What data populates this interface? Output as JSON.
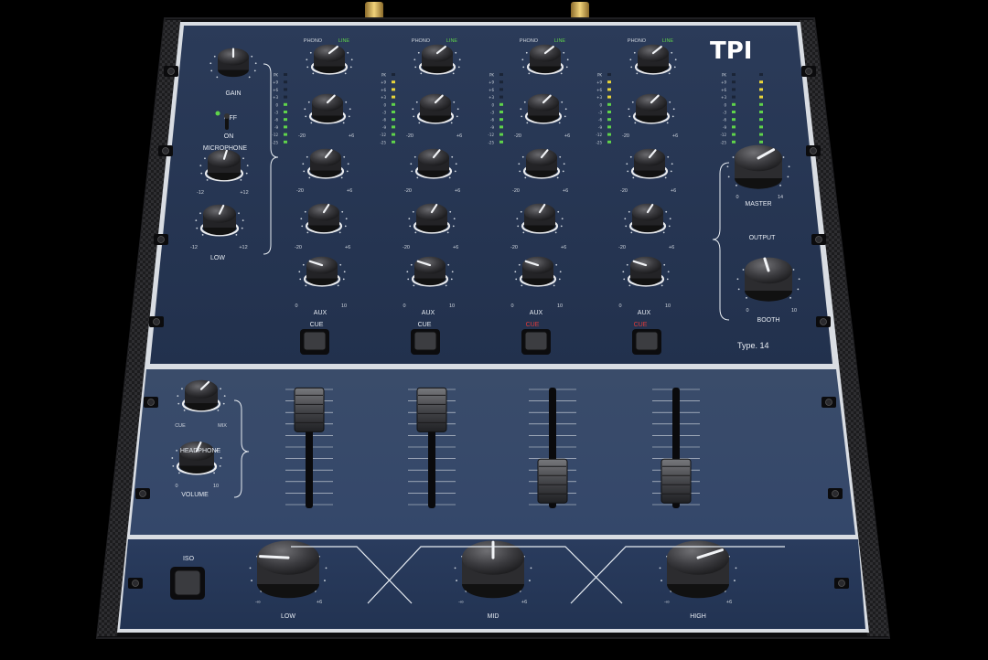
{
  "brand": "TPI",
  "model": "Type. 14",
  "colors": {
    "panel_top": "#2a3a58",
    "panel_mid": "#344664",
    "panel_bottom": "#26385a",
    "knob": "#2a2a2c",
    "led_green": "#5fd34a",
    "led_yellow": "#e7d43a",
    "led_red": "#e24a3a",
    "cue_red": "#e23a3a"
  },
  "mic": {
    "gain_label": "GAIN",
    "switch_off_label": "OFF",
    "switch_on_label": "ON",
    "section_label": "MICROPHONE",
    "low_label": "LOW",
    "range_min": "-12",
    "range_max": "+12"
  },
  "channels": {
    "source_labels": [
      "PHONO",
      "PHONO",
      "PHONO",
      "PHONO"
    ],
    "line_labels": [
      "LINE",
      "LINE",
      "LINE",
      "LINE"
    ],
    "eq_min": "-20",
    "eq_max": "+6",
    "aux_label": "AUX",
    "aux_min": "0",
    "aux_max": "10",
    "cue_label": "CUE",
    "cue_active": [
      false,
      false,
      true,
      true
    ],
    "fader_levels": [
      0.74,
      0.74,
      0.15,
      0.15
    ]
  },
  "meter_scale": [
    "PK",
    "+9",
    "+6",
    "+3",
    "0",
    "-3",
    "-6",
    "-9",
    "-12",
    "-25"
  ],
  "output": {
    "master_label": "MASTER",
    "master_min": "0",
    "master_max": "14",
    "section_label": "OUTPUT",
    "booth_label": "BOOTH",
    "booth_min": "0",
    "booth_max": "10"
  },
  "headphone": {
    "cue_label": "CUE",
    "mix_label": "MIX",
    "section_label": "HEADPHONE",
    "volume_label": "VOLUME",
    "vol_min": "0",
    "vol_max": "10"
  },
  "iso": {
    "button_label": "ISO",
    "low_label": "LOW",
    "mid_label": "MID",
    "high_label": "HIGH",
    "min": "-∞",
    "max": "+6"
  }
}
